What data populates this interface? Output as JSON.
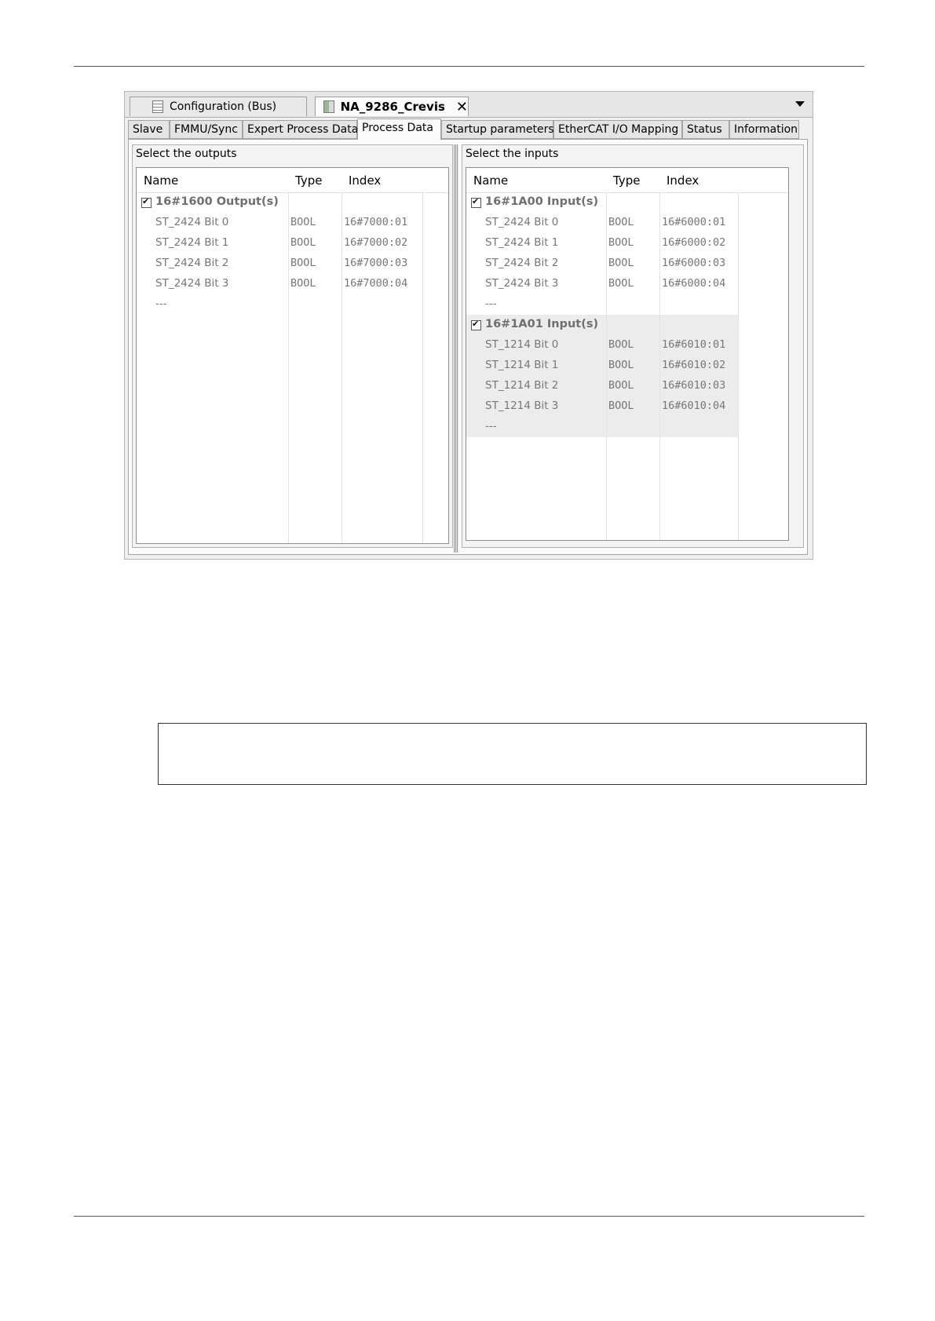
{
  "editor_tabs": [
    {
      "label": "Configuration (Bus)",
      "icon": "document-grid-icon"
    },
    {
      "label": "NA_9286_Crevis",
      "icon": "device-icon",
      "close": "✕"
    }
  ],
  "config_tabs": [
    "Slave",
    "FMMU/Sync",
    "Expert Process Data",
    "Process Data",
    "Startup parameters",
    "EtherCAT I/O Mapping",
    "Status",
    "Information"
  ],
  "active_config_tab": "Process Data",
  "outputs": {
    "title": "Select the outputs",
    "columns": [
      "Name",
      "Type",
      "Index"
    ],
    "groups": [
      {
        "name": "16#1600 Output(s)",
        "checked": true,
        "rows": [
          {
            "name": "ST_2424 Bit 0",
            "type": "BOOL",
            "index": "16#7000:01"
          },
          {
            "name": "ST_2424 Bit 1",
            "type": "BOOL",
            "index": "16#7000:02"
          },
          {
            "name": "ST_2424 Bit 2",
            "type": "BOOL",
            "index": "16#7000:03"
          },
          {
            "name": "ST_2424 Bit 3",
            "type": "BOOL",
            "index": "16#7000:04"
          },
          {
            "name": "---",
            "type": "",
            "index": ""
          }
        ]
      }
    ]
  },
  "inputs": {
    "title": "Select the inputs",
    "columns": [
      "Name",
      "Type",
      "Index"
    ],
    "groups": [
      {
        "name": "16#1A00 Input(s)",
        "checked": true,
        "rows": [
          {
            "name": "ST_2424 Bit 0",
            "type": "BOOL",
            "index": "16#6000:01"
          },
          {
            "name": "ST_2424 Bit 1",
            "type": "BOOL",
            "index": "16#6000:02"
          },
          {
            "name": "ST_2424 Bit 2",
            "type": "BOOL",
            "index": "16#6000:03"
          },
          {
            "name": "ST_2424 Bit 3",
            "type": "BOOL",
            "index": "16#6000:04"
          },
          {
            "name": "---",
            "type": "",
            "index": ""
          }
        ]
      },
      {
        "name": "16#1A01 Input(s)",
        "checked": true,
        "rows": [
          {
            "name": "ST_1214 Bit 0",
            "type": "BOOL",
            "index": "16#6010:01"
          },
          {
            "name": "ST_1214 Bit 1",
            "type": "BOOL",
            "index": "16#6010:02"
          },
          {
            "name": "ST_1214 Bit 2",
            "type": "BOOL",
            "index": "16#6010:03"
          },
          {
            "name": "ST_1214 Bit 3",
            "type": "BOOL",
            "index": "16#6010:04"
          },
          {
            "name": "---",
            "type": "",
            "index": ""
          }
        ]
      }
    ]
  }
}
